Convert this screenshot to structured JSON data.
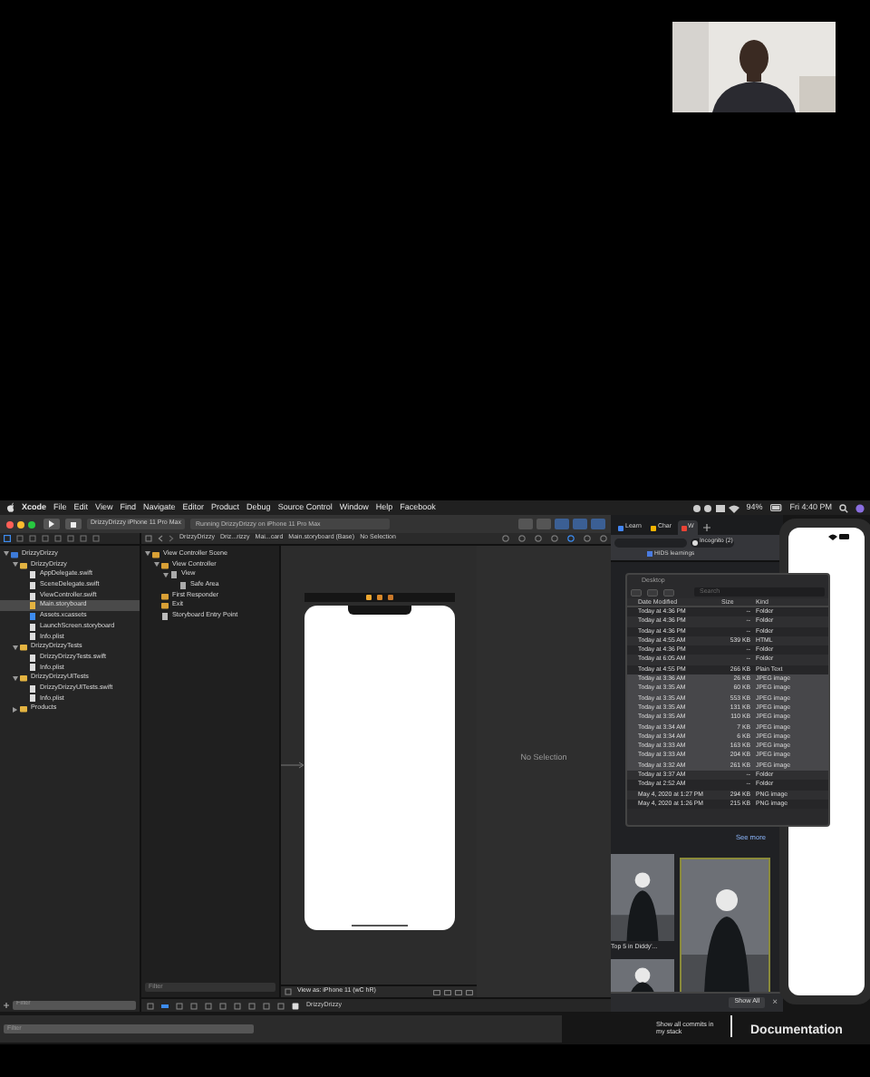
{
  "menu_bar": {
    "items": [
      "Xcode",
      "File",
      "Edit",
      "View",
      "Find",
      "Navigate",
      "Editor",
      "Product",
      "Debug",
      "Source Control",
      "Window",
      "Help",
      "Facebook"
    ],
    "battery": "94%",
    "clock": "Fri 4:40 PM"
  },
  "xcode": {
    "scheme": "DrizzyDrizzy",
    "device": "iPhone 11 Pro Max",
    "activity": "Running DrizzyDrizzy on iPhone 11 Pro Max",
    "jump_bar": [
      "DrizzyDrizzy",
      "Driz...rizzy",
      "Mai...card",
      "Main.storyboard (Base)",
      "No Selection"
    ],
    "navigator": [
      {
        "label": "DrizzyDrizzy",
        "kind": "project",
        "expanded": true,
        "selected": false,
        "children": [
          {
            "label": "DrizzyDrizzy",
            "kind": "folder",
            "expanded": true,
            "selected": false,
            "children": [
              {
                "label": "AppDelegate.swift",
                "kind": "file",
                "selected": false
              },
              {
                "label": "SceneDelegate.swift",
                "kind": "file",
                "selected": false
              },
              {
                "label": "ViewController.swift",
                "kind": "file",
                "selected": false
              },
              {
                "label": "Main.storyboard",
                "kind": "storyboard",
                "selected": true
              },
              {
                "label": "Assets.xcassets",
                "kind": "assets",
                "selected": false
              },
              {
                "label": "LaunchScreen.storyboard",
                "kind": "file",
                "selected": false
              },
              {
                "label": "Info.plist",
                "kind": "file",
                "selected": false
              }
            ]
          },
          {
            "label": "DrizzyDrizzyTests",
            "kind": "folder",
            "expanded": true,
            "selected": false,
            "children": [
              {
                "label": "DrizzyDrizzyTests.swift",
                "kind": "file",
                "selected": false
              },
              {
                "label": "Info.plist",
                "kind": "file",
                "selected": false
              }
            ]
          },
          {
            "label": "DrizzyDrizzyUITests",
            "kind": "folder",
            "expanded": true,
            "selected": false,
            "children": [
              {
                "label": "DrizzyDrizzyUITests.swift",
                "kind": "file",
                "selected": false
              },
              {
                "label": "Info.plist",
                "kind": "file",
                "selected": false
              }
            ]
          },
          {
            "label": "Products",
            "kind": "folder",
            "expanded": false,
            "selected": false
          }
        ]
      }
    ],
    "outline": [
      {
        "label": "View Controller Scene",
        "kind": "scene",
        "expanded": true,
        "children": [
          {
            "label": "View Controller",
            "kind": "scene",
            "expanded": true,
            "children": [
              {
                "label": "View",
                "kind": "view",
                "expanded": true,
                "children": [
                  {
                    "label": "Safe Area",
                    "kind": "view"
                  }
                ]
              }
            ]
          },
          {
            "label": "First Responder",
            "kind": "scene"
          },
          {
            "label": "Exit",
            "kind": "scene"
          },
          {
            "label": "Storyboard Entry Point",
            "kind": "entry"
          }
        ]
      }
    ],
    "view_as": "View as: iPhone 11 (wC hR)",
    "inspector": "No Selection",
    "debug_target": "DrizzyDrizzy",
    "filters": [
      {
        "placeholder": "Filter"
      },
      {
        "placeholder": "Filter"
      },
      {
        "placeholder": "Filter"
      }
    ]
  },
  "browser": {
    "tabs": [
      {
        "label": "Learn",
        "selected": false
      },
      {
        "label": "Char",
        "selected": false
      },
      {
        "label": "W",
        "selected": true
      }
    ],
    "incognito": "Incognito (2)",
    "bookmark": "HIDS learnings",
    "see_more": "See more",
    "caption": "Top 5 in Diddy'...",
    "show_all": "Show All",
    "close": "×"
  },
  "finder": {
    "location": "Desktop",
    "search": {
      "placeholder": "Search"
    },
    "columns": [
      "Date Modified",
      "Size",
      "Kind"
    ],
    "rows": [
      {
        "cells": [
          "Today at 4:36 PM",
          "--",
          "Folder"
        ],
        "selected": false
      },
      {
        "cells": [
          "Today at 4:36 PM",
          "--",
          "Folder"
        ],
        "selected": false
      },
      {
        "cells": [
          "Today at 4:36 PM",
          "--",
          "Folder"
        ],
        "selected": false
      },
      {
        "cells": [
          "Today at 4:55 AM",
          "539 KB",
          "HTML"
        ],
        "selected": false
      },
      {
        "cells": [
          "Today at 4:36 PM",
          "--",
          "Folder"
        ],
        "selected": false
      },
      {
        "cells": [
          "Today at 6:05 AM",
          "--",
          "Folder"
        ],
        "selected": false
      },
      {
        "cells": [
          "Today at 4:55 PM",
          "266 KB",
          "Plain Text"
        ],
        "selected": false
      },
      {
        "cells": [
          "Today at 3:36 AM",
          "26 KB",
          "JPEG image"
        ],
        "selected": true
      },
      {
        "cells": [
          "Today at 3:35 AM",
          "60 KB",
          "JPEG image"
        ],
        "selected": true
      },
      {
        "cells": [
          "Today at 3:35 AM",
          "553 KB",
          "JPEG image"
        ],
        "selected": true
      },
      {
        "cells": [
          "Today at 3:35 AM",
          "131 KB",
          "JPEG image"
        ],
        "selected": true
      },
      {
        "cells": [
          "Today at 3:35 AM",
          "110 KB",
          "JPEG image"
        ],
        "selected": true
      },
      {
        "cells": [
          "Today at 3:34 AM",
          "7 KB",
          "JPEG image"
        ],
        "selected": true
      },
      {
        "cells": [
          "Today at 3:34 AM",
          "6 KB",
          "JPEG image"
        ],
        "selected": true
      },
      {
        "cells": [
          "Today at 3:33 AM",
          "163 KB",
          "JPEG image"
        ],
        "selected": true
      },
      {
        "cells": [
          "Today at 3:33 AM",
          "204 KB",
          "JPEG image"
        ],
        "selected": true
      },
      {
        "cells": [
          "Today at 3:32 AM",
          "261 KB",
          "JPEG image"
        ],
        "selected": true
      },
      {
        "cells": [
          "Today at 3:37 AM",
          "--",
          "Folder"
        ],
        "selected": false
      },
      {
        "cells": [
          "Today at 2:52 AM",
          "--",
          "Folder"
        ],
        "selected": false
      },
      {
        "cells": [
          "May 4, 2020 at 1:27 PM",
          "294 KB",
          "PNG image"
        ],
        "selected": false
      },
      {
        "cells": [
          "May 4, 2020 at 1:26 PM",
          "215 KB",
          "PNG image"
        ],
        "selected": false
      }
    ]
  },
  "overlay": {
    "commits": "Show all commits in my stack",
    "documentation": "Documentation"
  }
}
